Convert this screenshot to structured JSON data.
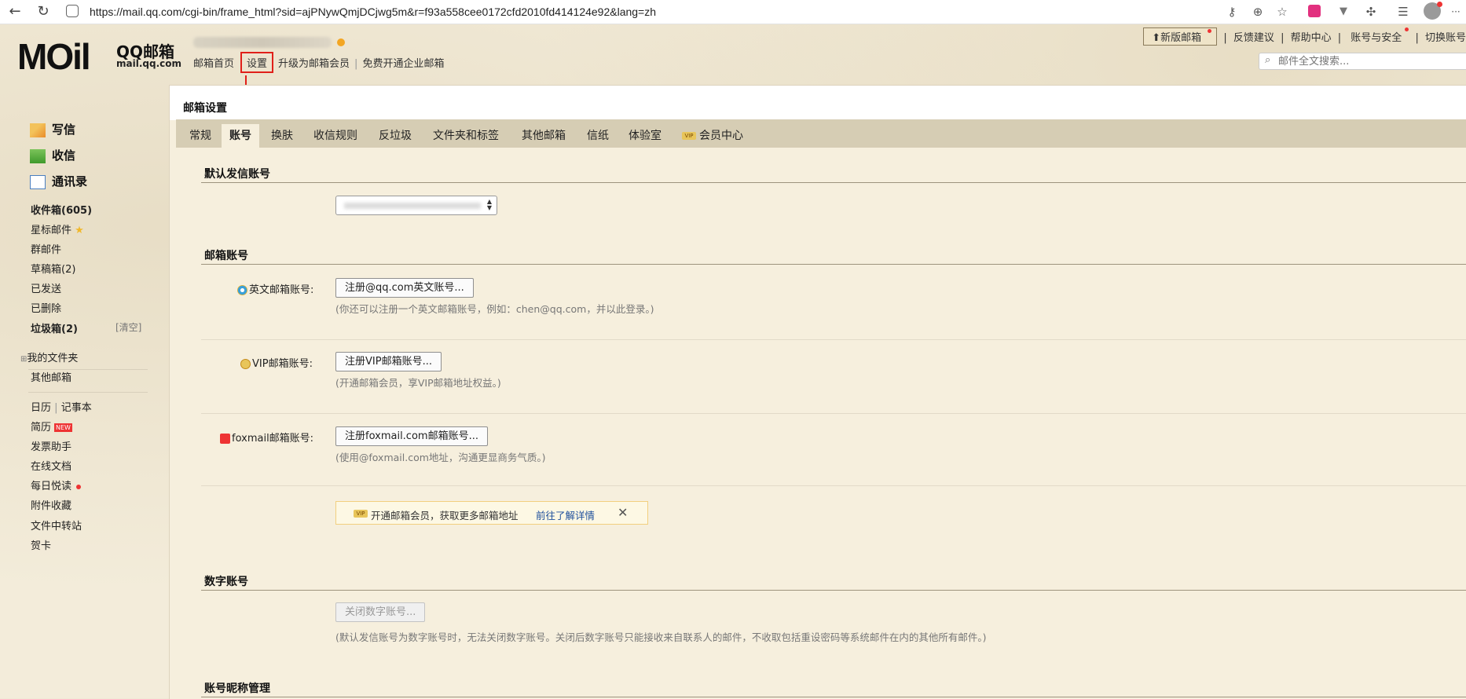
{
  "browser": {
    "url": "https://mail.qq.com/cgi-bin/frame_html?sid=ajPNywQmjDCjwg5m&r=f93a558cee0172cfd2010fd414124e92&lang=zh",
    "back_icon": "←",
    "refresh_icon": "↻",
    "more_icon": "···"
  },
  "logo": {
    "mail": "MOil",
    "qq": "QQ邮箱",
    "url": "mail.qq.com"
  },
  "topnav": {
    "home": "邮箱首页",
    "settings": "设置",
    "upgrade": "升级为邮箱会员",
    "sep": "|",
    "enterprise": "免费开通企业邮箱"
  },
  "toplinks": {
    "new_version": "⬆新版邮箱",
    "feedback": "反馈建议",
    "help": "帮助中心",
    "account_security": "账号与安全",
    "switch": "切换账号",
    "sep": "|"
  },
  "search": {
    "placeholder": "邮件全文搜索..."
  },
  "sidebar": {
    "compose": "写信",
    "receive": "收信",
    "contacts": "通讯录",
    "inbox": "收件箱(605)",
    "starred": "星标邮件",
    "star_icon": "★",
    "group": "群邮件",
    "drafts": "草稿箱(2)",
    "sent": "已发送",
    "deleted": "已删除",
    "spam": "垃圾箱(2)",
    "clear": "[清空]",
    "folders_toggle": "⊞",
    "my_folders": "我的文件夹",
    "other_mailbox": "其他邮箱",
    "calendar": "日历",
    "notes": "记事本",
    "sep": "|",
    "resume": "简历",
    "new_badge": "NEW",
    "invoice": "发票助手",
    "online_docs": "在线文档",
    "daily_read": "每日悦读",
    "attachments": "附件收藏",
    "file_transfer": "文件中转站",
    "cards": "贺卡"
  },
  "main": {
    "title": "邮箱设置",
    "tabs": [
      "常规",
      "账号",
      "换肤",
      "收信规则",
      "反垃圾",
      "文件夹和标签",
      "其他邮箱",
      "信纸",
      "体验室",
      "会员中心"
    ],
    "vip_tag": "VIP",
    "default_account_title": "默认发信账号",
    "mail_account_title": "邮箱账号",
    "en_label": "英文邮箱账号:",
    "en_button": "注册@qq.com英文账号...",
    "en_hint": "(你还可以注册一个英文邮箱账号，例如：chen@qq.com，并以此登录。)",
    "vip_label": "VIP邮箱账号:",
    "vip_button": "注册VIP邮箱账号...",
    "vip_hint": "(开通邮箱会员，享VIP邮箱地址权益。)",
    "foxmail_label": "foxmail邮箱账号:",
    "foxmail_button": "注册foxmail.com邮箱账号...",
    "foxmail_hint": "(使用@foxmail.com地址，沟通更显商务气质。)",
    "promo_text": "开通邮箱会员，获取更多邮箱地址",
    "promo_link": "前往了解详情",
    "promo_close": "✕",
    "digital_title": "数字账号",
    "digital_button": "关闭数字账号...",
    "digital_hint": "(默认发信账号为数字账号时，无法关闭数字账号。关闭后数字账号只能接收来自联系人的邮件，不收取包括重设密码等系统邮件在内的其他所有邮件。)",
    "nickname_title": "账号昵称管理"
  }
}
